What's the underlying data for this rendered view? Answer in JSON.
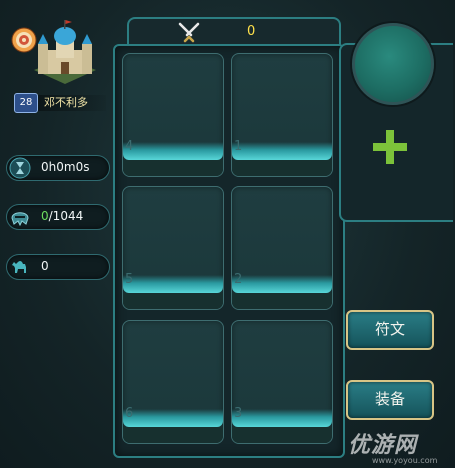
{
  "player": {
    "level": "28",
    "name": "邓不利多"
  },
  "stats": {
    "timer": "0h0m0s",
    "army_current": "0",
    "army_max": "/1044",
    "camels": "0"
  },
  "battle": {
    "score": "0"
  },
  "slots": [
    {
      "index": "4"
    },
    {
      "index": "1"
    },
    {
      "index": "5"
    },
    {
      "index": "2"
    },
    {
      "index": "6"
    },
    {
      "index": "3"
    }
  ],
  "buttons": {
    "runes": "符文",
    "equipment": "装备"
  },
  "watermark": {
    "brand": "优游网",
    "url": "www.yoyou.com"
  },
  "colors": {
    "accent": "#2c7e82",
    "highlight": "#ffe14b",
    "plus": "#7cc23a"
  }
}
